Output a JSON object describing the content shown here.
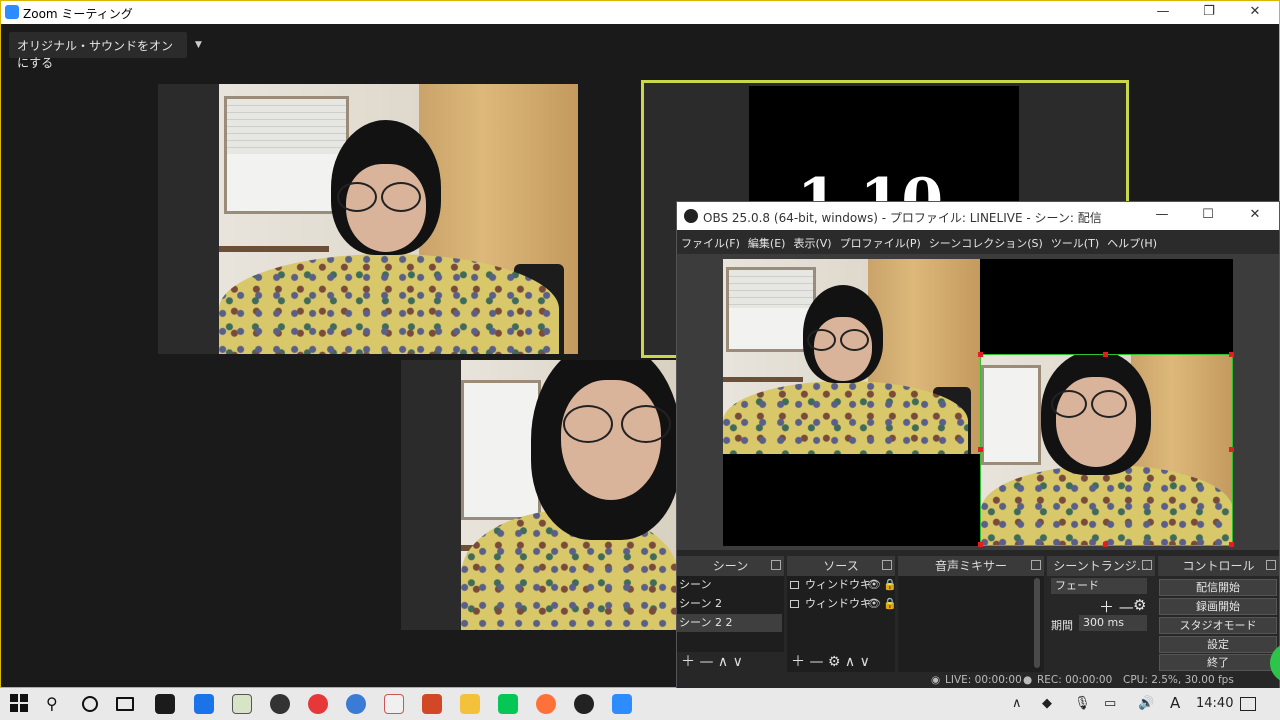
{
  "zoom": {
    "title": "Zoom ミーティング",
    "original_sound_button": "オリジナル・サウンドをオンにする",
    "dropdown_glyph": "▼",
    "window_controls": {
      "minimize": "—",
      "restore": "❐",
      "close": "✕"
    },
    "active_speaker_color": "#c8d84a",
    "shared_screen_text": "1 10"
  },
  "obs": {
    "title": "OBS 25.0.8 (64-bit, windows) - プロファイル: LINELIVE - シーン: 配信",
    "window_controls": {
      "minimize": "—",
      "maximize": "☐",
      "close": "✕"
    },
    "menu": [
      "ファイル(F)",
      "編集(E)",
      "表示(V)",
      "プロファイル(P)",
      "シーンコレクション(S)",
      "ツール(T)",
      "ヘルプ(H)"
    ],
    "docks": {
      "scenes": {
        "title": "シーン",
        "items": [
          "シーン",
          "シーン 2",
          "シーン 2 2"
        ],
        "selected_index": 2,
        "footer": "＋ —   ∧ ∨"
      },
      "sources": {
        "title": "ソース",
        "items": [
          "ウィンドウキ",
          "ウィンドウキ"
        ],
        "footer": "＋ — ⚙  ∧ ∨"
      },
      "mixer": {
        "title": "音声ミキサー"
      },
      "transitions": {
        "title": "シーントランジ…",
        "transition_value": "フェード",
        "add_remove": "＋ —",
        "gear": "⚙",
        "duration_label": "期間",
        "duration_value": "300 ms"
      },
      "controls": {
        "title": "コントロール",
        "buttons": [
          "配信開始",
          "録画開始",
          "スタジオモード",
          "設定",
          "終了"
        ]
      }
    },
    "status": {
      "live": "LIVE: 00:00:00",
      "rec": "REC: 00:00:00",
      "cpu": "CPU: 2.5%, 30.00 fps"
    }
  },
  "taskbar": {
    "icons": [
      "windows-start",
      "search",
      "cortana",
      "task-view",
      "store",
      "mail",
      "photos",
      "davinci",
      "headphones",
      "globe",
      "paint",
      "powerpoint",
      "explorer",
      "line",
      "firefox",
      "obs",
      "zoom"
    ],
    "tray": {
      "up_arrow": "∧",
      "ime": "A",
      "time": "14:40"
    }
  }
}
